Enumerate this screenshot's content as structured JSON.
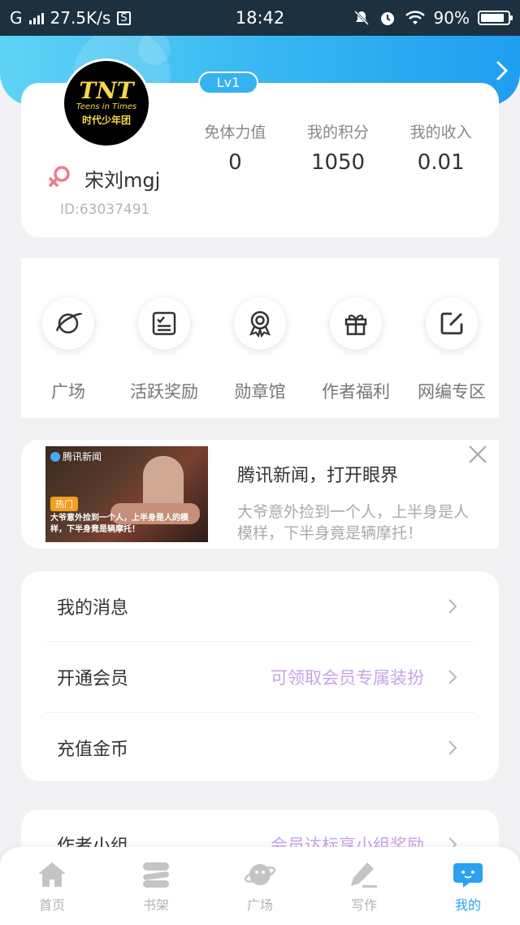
{
  "status_bar": {
    "carrier": "G",
    "speed": "27.5K/s",
    "s_badge": "S",
    "time": "18:42",
    "battery": "90%",
    "battery_level": 0.9
  },
  "profile": {
    "level": "Lv1",
    "avatar_logo": "TNT",
    "avatar_sub": "Teens in Times",
    "avatar_cn": "时代少年团",
    "username": "宋刘mgj",
    "user_id": "ID:63037491",
    "stats": [
      {
        "label": "免体力值",
        "value": "0"
      },
      {
        "label": "我的积分",
        "value": "1050"
      },
      {
        "label": "我的收入",
        "value": "0.01"
      }
    ]
  },
  "quick_actions": [
    {
      "label": "广场",
      "icon": "planet-icon"
    },
    {
      "label": "活跃奖励",
      "icon": "checklist-icon"
    },
    {
      "label": "勋章馆",
      "icon": "medal-icon"
    },
    {
      "label": "作者福利",
      "icon": "gift-icon"
    },
    {
      "label": "网编专区",
      "icon": "edit-icon"
    }
  ],
  "ad": {
    "source": "腾讯新闻",
    "hot_tag": "热门",
    "caption": "大爷意外捡到一个人，上半身是人的模样，下半身竟是辆摩托！",
    "title": "腾讯新闻，打开眼界",
    "desc_line1": "大爷意外捡到一个人，上半身是人",
    "desc_line2": "模样，下半身竟是辆摩托！"
  },
  "menu": [
    {
      "label": "我的消息",
      "hint": ""
    },
    {
      "label": "开通会员",
      "hint": "可领取会员专属装扮"
    },
    {
      "label": "充值金币",
      "hint": ""
    }
  ],
  "menu2": [
    {
      "label": "作者小组",
      "hint": "会员达标享小组奖励"
    }
  ],
  "tabs": [
    {
      "label": "首页",
      "icon": "home-icon",
      "active": false
    },
    {
      "label": "书架",
      "icon": "bookshelf-icon",
      "active": false
    },
    {
      "label": "广场",
      "icon": "planet-icon",
      "active": false
    },
    {
      "label": "写作",
      "icon": "pen-icon",
      "active": false
    },
    {
      "label": "我的",
      "icon": "chat-face-icon",
      "active": true
    }
  ],
  "colors": {
    "accent": "#2aa2ee",
    "header_start": "#5fd3f5",
    "header_end": "#1f9df0",
    "hint_purple": "#c9a3e6",
    "gender_pink": "#f07a8c"
  }
}
